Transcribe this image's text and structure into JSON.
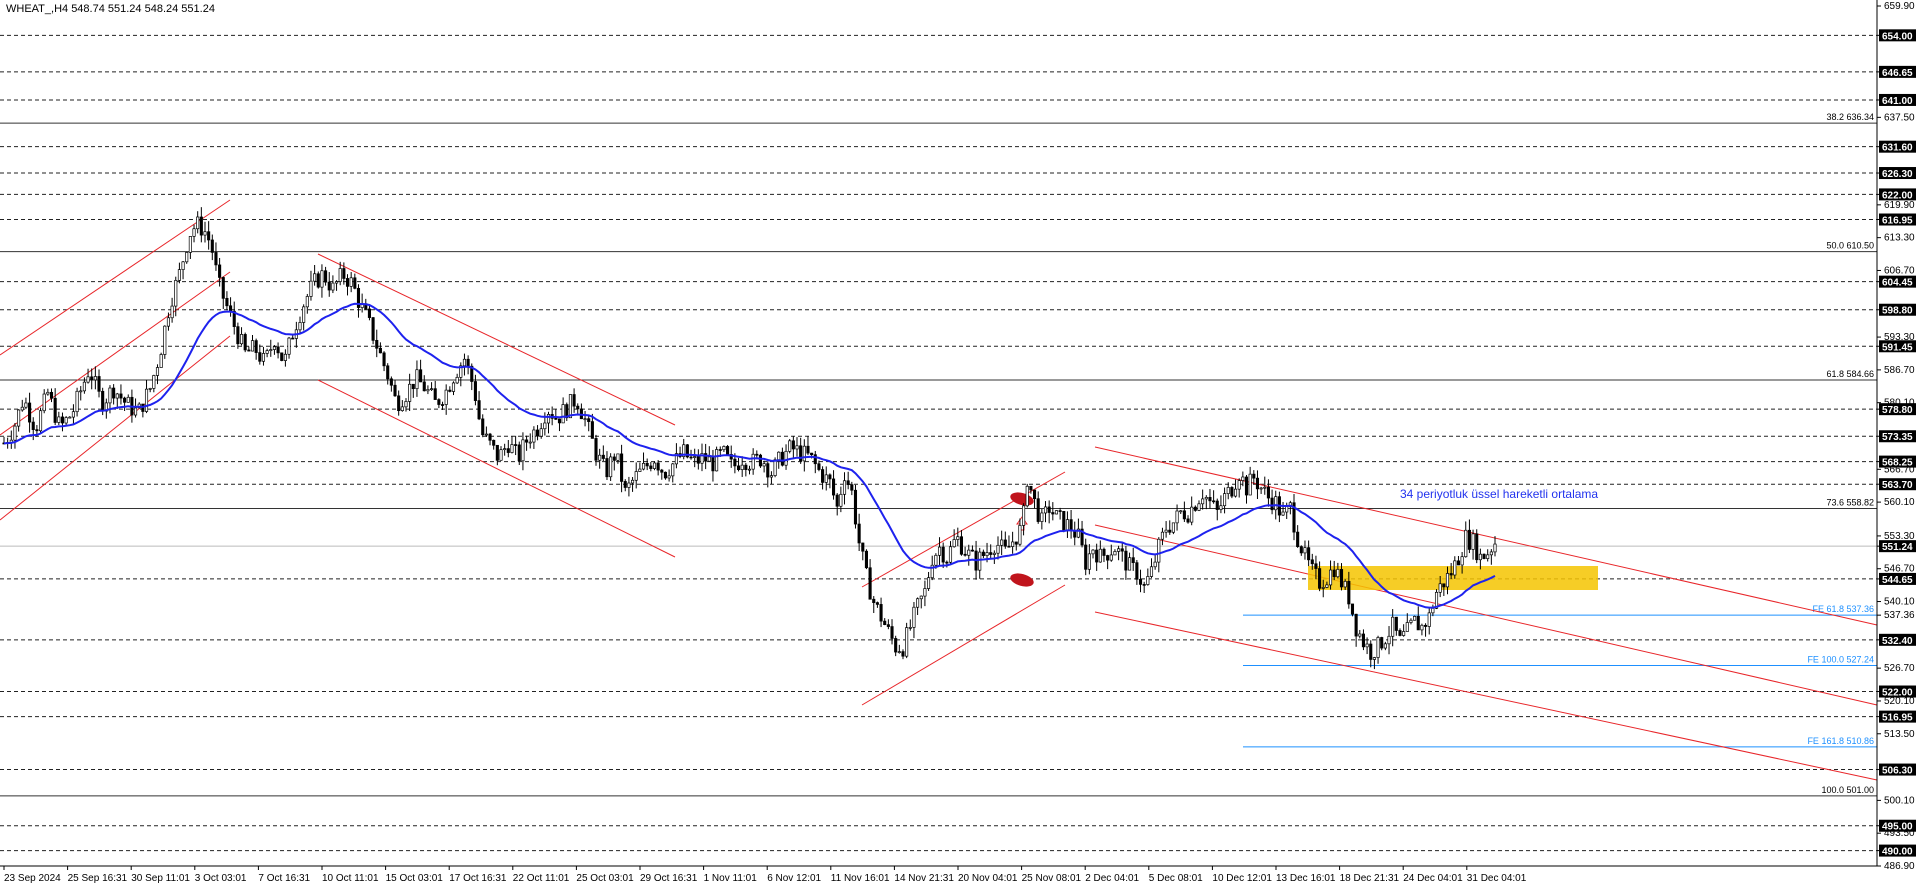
{
  "chart_data": {
    "type": "candlestick",
    "symbol_line": "WHEAT_,H4  548.74 551.24 548.24 551.24",
    "ylim": [
      486.9,
      659.9
    ],
    "y_ticks": [
      "659.90",
      "654.00",
      "646.65",
      "641.00",
      "637.50",
      "631.60",
      "626.30",
      "622.00",
      "619.90",
      "616.95",
      "613.30",
      "606.70",
      "604.45",
      "598.80",
      "593.30",
      "591.45",
      "586.70",
      "580.10",
      "578.80",
      "573.35",
      "568.25",
      "566.70",
      "563.70",
      "560.10",
      "553.30",
      "551.24",
      "546.70",
      "544.65",
      "540.10",
      "537.36",
      "532.40",
      "526.70",
      "522.00",
      "520.10",
      "516.95",
      "513.50",
      "506.30",
      "500.10",
      "495.00",
      "493.50",
      "490.00",
      "486.90"
    ],
    "horizontal_levels": [
      {
        "value": 654.0,
        "label": "654.00",
        "style": "dashed"
      },
      {
        "value": 646.65,
        "label": "646.65",
        "style": "dashed"
      },
      {
        "value": 641.0,
        "label": "641.00",
        "style": "dashed"
      },
      {
        "value": 631.6,
        "label": "631.60",
        "style": "dashed"
      },
      {
        "value": 626.3,
        "label": "626.30",
        "style": "dashed"
      },
      {
        "value": 622.0,
        "label": "622.00",
        "style": "dashed"
      },
      {
        "value": 616.95,
        "label": "616.95",
        "style": "dashed"
      },
      {
        "value": 604.45,
        "label": "604.45",
        "style": "dashed"
      },
      {
        "value": 598.8,
        "label": "598.80",
        "style": "dashed"
      },
      {
        "value": 591.45,
        "label": "591.45",
        "style": "dashed"
      },
      {
        "value": 578.8,
        "label": "578.80",
        "style": "dashed"
      },
      {
        "value": 573.35,
        "label": "573.35",
        "style": "dashed"
      },
      {
        "value": 568.25,
        "label": "568.25",
        "style": "dashed"
      },
      {
        "value": 563.7,
        "label": "563.70",
        "style": "dashed"
      },
      {
        "value": 544.65,
        "label": "544.65",
        "style": "dashed"
      },
      {
        "value": 532.4,
        "label": "532.40",
        "style": "dashed"
      },
      {
        "value": 522.0,
        "label": "522.00",
        "style": "dashed"
      },
      {
        "value": 516.95,
        "label": "516.95",
        "style": "dashed"
      },
      {
        "value": 506.3,
        "label": "506.30",
        "style": "dashed"
      },
      {
        "value": 495.0,
        "label": "495.00",
        "style": "dashed"
      },
      {
        "value": 490.0,
        "label": "490.00",
        "style": "dashed"
      }
    ],
    "fib_levels": [
      {
        "value": 636.34,
        "label": "38.2 636.34"
      },
      {
        "value": 610.5,
        "label": "50.0 610.50"
      },
      {
        "value": 584.66,
        "label": "61.8 584.66"
      },
      {
        "value": 558.82,
        "label": "73.6 558.82"
      },
      {
        "value": 501.0,
        "label": "100.0 501.00"
      }
    ],
    "fe_levels": [
      {
        "value": 537.36,
        "label": "FE 61.8 537.36"
      },
      {
        "value": 527.24,
        "label": "FE 100.0 527.24"
      },
      {
        "value": 510.86,
        "label": "FE 161.8 510.86"
      }
    ],
    "current_price": {
      "value": 551.24,
      "label": "551.24"
    },
    "x_labels": [
      "23 Sep 2024",
      "25 Sep 16:31",
      "30 Sep 11:01",
      "3 Oct 03:01",
      "7 Oct 16:31",
      "10 Oct 11:01",
      "15 Oct 03:01",
      "17 Oct 16:31",
      "22 Oct 11:01",
      "25 Oct 03:01",
      "29 Oct 16:31",
      "1 Nov 11:01",
      "6 Nov 12:01",
      "11 Nov 16:01",
      "14 Nov 21:31",
      "20 Nov 04:01",
      "25 Nov 08:01",
      "2 Dec 04:01",
      "5 Dec 08:01",
      "10 Dec 12:01",
      "13 Dec 16:01",
      "18 Dec 21:31",
      "24 Dec 04:01",
      "31 Dec 04:01"
    ],
    "close_path": [
      [
        0,
        572
      ],
      [
        8,
        575
      ],
      [
        16,
        581
      ],
      [
        26,
        575
      ],
      [
        36,
        582
      ],
      [
        46,
        575
      ],
      [
        56,
        578
      ],
      [
        70,
        587
      ],
      [
        80,
        580
      ],
      [
        90,
        583
      ],
      [
        100,
        580
      ],
      [
        110,
        578
      ],
      [
        120,
        583
      ],
      [
        128,
        590
      ],
      [
        136,
        600
      ],
      [
        144,
        606
      ],
      [
        152,
        614
      ],
      [
        158,
        616
      ],
      [
        164,
        615
      ],
      [
        170,
        612
      ],
      [
        176,
        604
      ],
      [
        182,
        600
      ],
      [
        190,
        595
      ],
      [
        198,
        590
      ],
      [
        206,
        591
      ],
      [
        214,
        588
      ],
      [
        222,
        593
      ],
      [
        230,
        588
      ],
      [
        238,
        595
      ],
      [
        246,
        600
      ],
      [
        254,
        604
      ],
      [
        262,
        606
      ],
      [
        270,
        603
      ],
      [
        278,
        606
      ],
      [
        286,
        604
      ],
      [
        292,
        600
      ],
      [
        298,
        597
      ],
      [
        304,
        593
      ],
      [
        310,
        589
      ],
      [
        316,
        585
      ],
      [
        322,
        580
      ],
      [
        330,
        582
      ],
      [
        338,
        585
      ],
      [
        346,
        583
      ],
      [
        354,
        580
      ],
      [
        362,
        582
      ],
      [
        370,
        586
      ],
      [
        378,
        589
      ],
      [
        386,
        583
      ],
      [
        392,
        574
      ],
      [
        398,
        572
      ],
      [
        406,
        569
      ],
      [
        414,
        572
      ],
      [
        422,
        569
      ],
      [
        430,
        573
      ],
      [
        438,
        575
      ],
      [
        446,
        579
      ],
      [
        454,
        577
      ],
      [
        462,
        579
      ],
      [
        470,
        581
      ],
      [
        478,
        576
      ],
      [
        486,
        570
      ],
      [
        494,
        566
      ],
      [
        502,
        570
      ],
      [
        510,
        562
      ],
      [
        518,
        565
      ],
      [
        526,
        567
      ],
      [
        534,
        569
      ],
      [
        542,
        566
      ],
      [
        550,
        568
      ],
      [
        558,
        570
      ],
      [
        566,
        568
      ],
      [
        574,
        569
      ],
      [
        582,
        568
      ],
      [
        590,
        570
      ],
      [
        598,
        567
      ],
      [
        606,
        569
      ],
      [
        614,
        568
      ],
      [
        622,
        569
      ],
      [
        630,
        566
      ],
      [
        638,
        569
      ],
      [
        646,
        571
      ],
      [
        654,
        570
      ],
      [
        662,
        569
      ],
      [
        670,
        566
      ],
      [
        678,
        564
      ],
      [
        684,
        559
      ],
      [
        690,
        566
      ],
      [
        696,
        562
      ],
      [
        702,
        552
      ],
      [
        708,
        545
      ],
      [
        714,
        540
      ],
      [
        720,
        537
      ],
      [
        726,
        534
      ],
      [
        732,
        531
      ],
      [
        738,
        531
      ],
      [
        744,
        535
      ],
      [
        750,
        539
      ],
      [
        756,
        542
      ],
      [
        762,
        549
      ],
      [
        768,
        551
      ],
      [
        774,
        549
      ],
      [
        782,
        553
      ],
      [
        790,
        550
      ],
      [
        798,
        548
      ],
      [
        806,
        550
      ],
      [
        814,
        552
      ],
      [
        822,
        550
      ],
      [
        830,
        553
      ],
      [
        836,
        555
      ],
      [
        840,
        565
      ],
      [
        846,
        560
      ],
      [
        852,
        556
      ],
      [
        858,
        559
      ],
      [
        864,
        557
      ],
      [
        870,
        556
      ],
      [
        876,
        555
      ],
      [
        882,
        553
      ],
      [
        888,
        548
      ],
      [
        894,
        551
      ],
      [
        900,
        549
      ],
      [
        906,
        550
      ],
      [
        912,
        551
      ],
      [
        918,
        549
      ],
      [
        924,
        547
      ],
      [
        930,
        546
      ],
      [
        936,
        543
      ],
      [
        942,
        546
      ],
      [
        948,
        551
      ],
      [
        954,
        555
      ],
      [
        960,
        556
      ],
      [
        966,
        558
      ],
      [
        972,
        558
      ],
      [
        978,
        560
      ],
      [
        984,
        562
      ],
      [
        990,
        560
      ],
      [
        996,
        558
      ],
      [
        1002,
        561
      ],
      [
        1008,
        563
      ],
      [
        1014,
        566
      ],
      [
        1020,
        563
      ],
      [
        1026,
        565
      ],
      [
        1032,
        563
      ],
      [
        1038,
        561
      ],
      [
        1044,
        560
      ],
      [
        1050,
        557
      ],
      [
        1056,
        559
      ],
      [
        1062,
        553
      ],
      [
        1068,
        549
      ],
      [
        1074,
        546
      ],
      [
        1080,
        544
      ],
      [
        1086,
        545
      ],
      [
        1092,
        547
      ],
      [
        1098,
        544
      ],
      [
        1104,
        541
      ],
      [
        1110,
        535
      ],
      [
        1116,
        532
      ],
      [
        1122,
        530
      ],
      [
        1128,
        531
      ],
      [
        1134,
        533
      ],
      [
        1140,
        535
      ],
      [
        1146,
        532
      ],
      [
        1152,
        534
      ],
      [
        1158,
        536
      ],
      [
        1164,
        535
      ],
      [
        1170,
        537
      ],
      [
        1176,
        542
      ],
      [
        1182,
        544
      ],
      [
        1188,
        546
      ],
      [
        1194,
        549
      ],
      [
        1200,
        553
      ],
      [
        1206,
        552
      ],
      [
        1212,
        549
      ],
      [
        1218,
        550
      ],
      [
        1224,
        552
      ]
    ],
    "ema": {
      "name": "34 periyotluk üssel hareketli ortalama",
      "color": "#1E22EE"
    },
    "channel_color": "#E8262A",
    "zone_color": "#F5C400",
    "annotation": "34 periyotluk üssel hareketli ortalama"
  }
}
